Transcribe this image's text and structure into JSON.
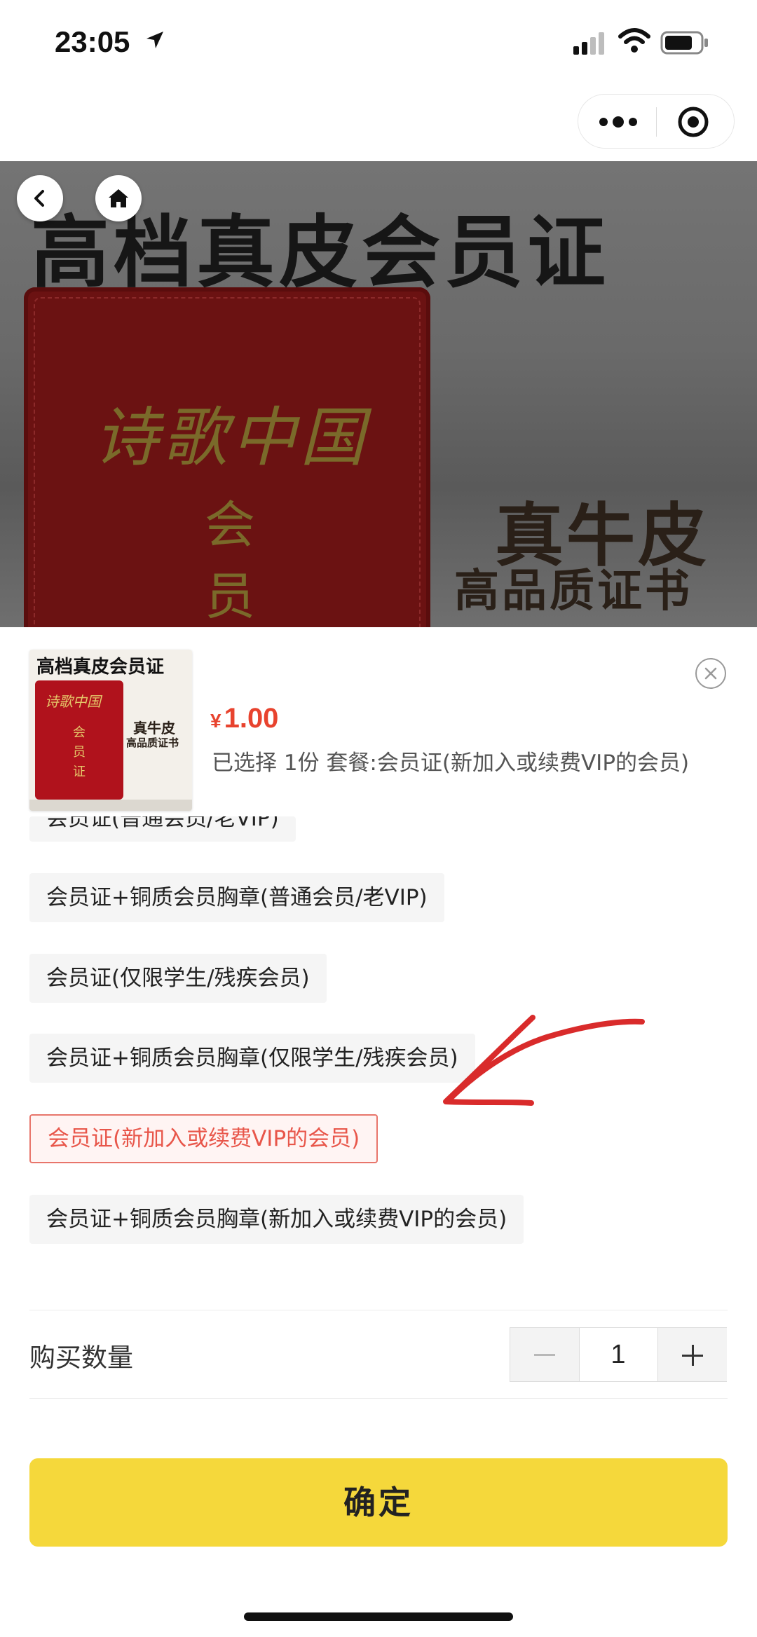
{
  "status_bar": {
    "time": "23:05"
  },
  "hero": {
    "title": "高档真皮会员证",
    "book_calligraphy": "诗歌中国",
    "book_chars": [
      "会",
      "员"
    ],
    "subtitle_1": "真牛皮",
    "subtitle_2": "高品质证书"
  },
  "sheet": {
    "thumbnail": {
      "title": "高档真皮会员证",
      "calligraphy": "诗歌中国",
      "vertical_chars": [
        "会",
        "员",
        "证"
      ],
      "sub_1": "真牛皮",
      "sub_2": "高品质证书"
    },
    "price": {
      "currency": "¥",
      "value": "1.00"
    },
    "selected_info": "已选择 1份 套餐:会员证(新加入或续费VIP的会员)",
    "options": [
      {
        "label": "会员证(普通会员/老VIP)",
        "selected": false
      },
      {
        "label": "会员证+铜质会员胸章(普通会员/老VIP)",
        "selected": false
      },
      {
        "label": "会员证(仅限学生/残疾会员)",
        "selected": false
      },
      {
        "label": "会员证+铜质会员胸章(仅限学生/残疾会员)",
        "selected": false
      },
      {
        "label": "会员证(新加入或续费VIP的会员)",
        "selected": true
      },
      {
        "label": "会员证+铜质会员胸章(新加入或续费VIP的会员)",
        "selected": false
      }
    ],
    "quantity_label": "购买数量",
    "quantity_value": "1",
    "confirm_label": "确定"
  },
  "colors": {
    "accent_yellow": "#f5d83b",
    "price_red": "#e8432e",
    "selected_border": "#e8756b",
    "annotation_red": "#d92b2b"
  },
  "icons": [
    "location-arrow-icon",
    "signal-icon",
    "wifi-icon",
    "battery-icon",
    "more-icon",
    "target-icon",
    "back-icon",
    "home-icon",
    "close-icon",
    "minus-icon",
    "plus-icon"
  ]
}
